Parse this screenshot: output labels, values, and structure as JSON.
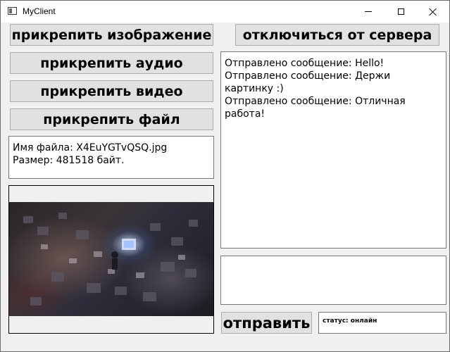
{
  "window": {
    "title": "MyClient",
    "icon": "app-window-icon",
    "controls": [
      "minimize-icon",
      "maximize-icon",
      "close-icon"
    ]
  },
  "attach": {
    "image_label": "прикрепить изображение",
    "audio_label": "прикрепить аудио",
    "video_label": "прикрепить видео",
    "file_label": "прикрепить файл"
  },
  "file_info": {
    "name_line": "Имя файла: X4EuYGTvQSQ.jpg",
    "size_line": "Размер: 481518 байт."
  },
  "server": {
    "disconnect_label": "отключиться от сервера"
  },
  "chat": {
    "messages": [
      "Отправлено сообщение: Hello!",
      "Отправлено сообщение: Держи картинку :)",
      "Отправлено сообщение: Отличная работа!"
    ]
  },
  "compose": {
    "value": "",
    "send_label": "отправить"
  },
  "status": {
    "text": "статус: онлайн"
  }
}
